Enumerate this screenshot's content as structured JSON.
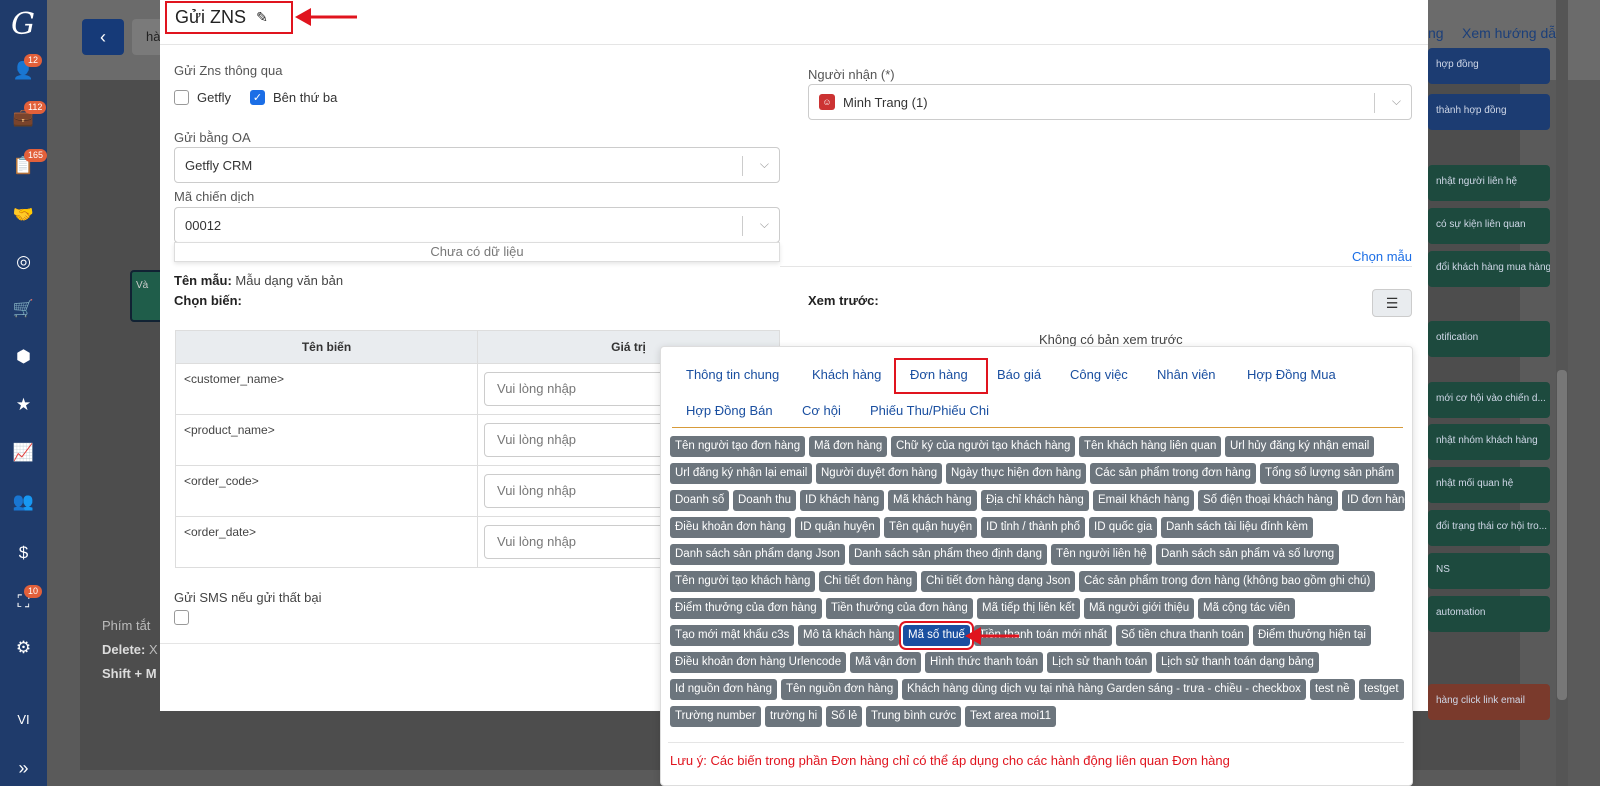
{
  "sidebar": {
    "badges": [
      "12",
      "112",
      "165",
      "10"
    ],
    "lang": "VI"
  },
  "background": {
    "search_text": "hà",
    "header_link_left": "ng",
    "header_link_right": "Xem hướng dẫn",
    "node_label": "Và",
    "help": {
      "title": "Phím tắt",
      "delete": "Delete:",
      "delete_rest": "X",
      "shift": "Shift + M"
    },
    "right_buttons": [
      {
        "label": "hợp đồng",
        "color": "blue"
      },
      {
        "label": "thành hợp đồng",
        "color": "blue"
      },
      {
        "label": "nhật người liên hệ",
        "color": "green"
      },
      {
        "label": "có sự kiện liên quan",
        "color": "green"
      },
      {
        "label": "đổi khách hàng mua hàng",
        "color": "green"
      },
      {
        "label": "otification",
        "color": "green"
      },
      {
        "label": "mới cơ hội vào chiến d...",
        "color": "green"
      },
      {
        "label": "nhật nhóm khách hàng",
        "color": "green"
      },
      {
        "label": "nhật mối quan hệ",
        "color": "green"
      },
      {
        "label": "đổi trạng thái cơ hội tro...",
        "color": "green"
      },
      {
        "label": "NS",
        "color": "green"
      },
      {
        "label": "automation",
        "color": "green"
      },
      {
        "label": "hàng click link email",
        "color": "red"
      }
    ]
  },
  "modal": {
    "title": "Gửi ZNS",
    "send_via_label": "Gửi Zns thông qua",
    "opt_getfly": "Getfly",
    "opt_third": "Bên thứ ba",
    "oa_label": "Gửi bằng OA",
    "oa_value": "Getfly CRM",
    "campaign_label": "Mã chiến dịch",
    "campaign_value": "00012",
    "campaign_empty": "Chưa có dữ liệu",
    "recipient_label": "Người nhận (*)",
    "recipient_value": "Minh Trang (1)",
    "choose_template": "Chọn mẫu",
    "template_name_label": "Tên mẫu:",
    "template_name_value": "Mẫu dạng văn bản",
    "choose_var_label": "Chọn biến:",
    "preview_label": "Xem trước:",
    "no_preview": "Không có bản xem trước",
    "table_headers": [
      "Tên biến",
      "Giá trị"
    ],
    "table_rows": [
      {
        "name": "<customer_name>",
        "placeholder": "Vui lòng nhập"
      },
      {
        "name": "<product_name>",
        "placeholder": "Vui lòng nhập"
      },
      {
        "name": "<order_code>",
        "placeholder": "Vui lòng nhập"
      },
      {
        "name": "<order_date>",
        "placeholder": "Vui lòng nhập"
      }
    ],
    "sms_fallback": "Gửi SMS nếu gửi thất bại"
  },
  "popover": {
    "tabs": [
      "Thông tin chung",
      "Khách hàng",
      "Đơn hàng",
      "Báo giá",
      "Công việc",
      "Nhân viên",
      "Hợp Đồng Mua",
      "Hợp Đồng Bán",
      "Cơ hội",
      "Phiếu Thu/Phiếu Chi"
    ],
    "active_tab": "Đơn hàng",
    "tag_rows": [
      [
        "Tên người tạo đơn hàng",
        "Mã đơn hàng",
        "Chữ ký của người tạo khách hàng",
        "Tên khách hàng liên quan",
        "Url hủy đăng ký nhận email"
      ],
      [
        "Url đăng ký nhận lại email",
        "Người duyệt đơn hàng",
        "Ngày thực hiện đơn hàng",
        "Các sản phẩm trong đơn hàng",
        "Tổng số lượng sản phẩm"
      ],
      [
        "Doanh số",
        "Doanh thu",
        "ID khách hàng",
        "Mã khách hàng",
        "Địa chỉ khách hàng",
        "Email khách hàng",
        "Số điện thoại khách hàng",
        "ID đơn hàng"
      ],
      [
        "Điều khoản đơn hàng",
        "ID quận huyện",
        "Tên quận huyện",
        "ID tỉnh / thành phố",
        "ID quốc gia",
        "Danh sách tài liệu đính kèm"
      ],
      [
        "Danh sách sản phẩm dạng Json",
        "Danh sách sản phẩm theo định dạng",
        "Tên người liên hệ",
        "Danh sách sản phẩm và số lượng"
      ],
      [
        "Tên người tạo khách hàng",
        "Chi tiết đơn hàng",
        "Chi tiết đơn hàng dạng Json",
        "Các sản phẩm trong đơn hàng (không bao gồm ghi chú)"
      ],
      [
        "Điểm thưởng của đơn hàng",
        "Tiền thưởng của đơn hàng",
        "Mã tiếp thị liên kết",
        "Mã người giới thiệu",
        "Mã cộng tác viên"
      ],
      [
        "Tạo mới mật khẩu c3s",
        "Mô tả khách hàng",
        "Mã số thuế",
        "Tiền thanh toán mới nhất",
        "Số tiền chưa thanh toán",
        "Điểm thưởng hiện tại"
      ],
      [
        "Điều khoản đơn hàng Urlencode",
        "Mã vận đơn",
        "Hình thức thanh toán",
        "Lịch sử thanh toán",
        "Lịch sử thanh toán dạng bảng"
      ],
      [
        "Id nguồn đơn hàng",
        "Tên nguồn đơn hàng",
        "Khách hàng dùng dịch vụ tại nhà hàng Garden sáng - trưa - chiều - checkbox",
        "test nề",
        "testget"
      ],
      [
        "Trường number",
        "trường hi",
        "Số lẻ",
        "Trung bình cước",
        "Text area moi11"
      ]
    ],
    "selected_tag": "Mã số thuế",
    "note": "Lưu ý: Các biến trong phần Đơn hàng chỉ có thể áp dụng cho các hành động liên quan Đơn hàng"
  },
  "colors": {
    "sidebar": "#1f3b6b",
    "accent": "#1a4fa0",
    "tag": "#6c757d",
    "highlight": "#e0141e"
  }
}
